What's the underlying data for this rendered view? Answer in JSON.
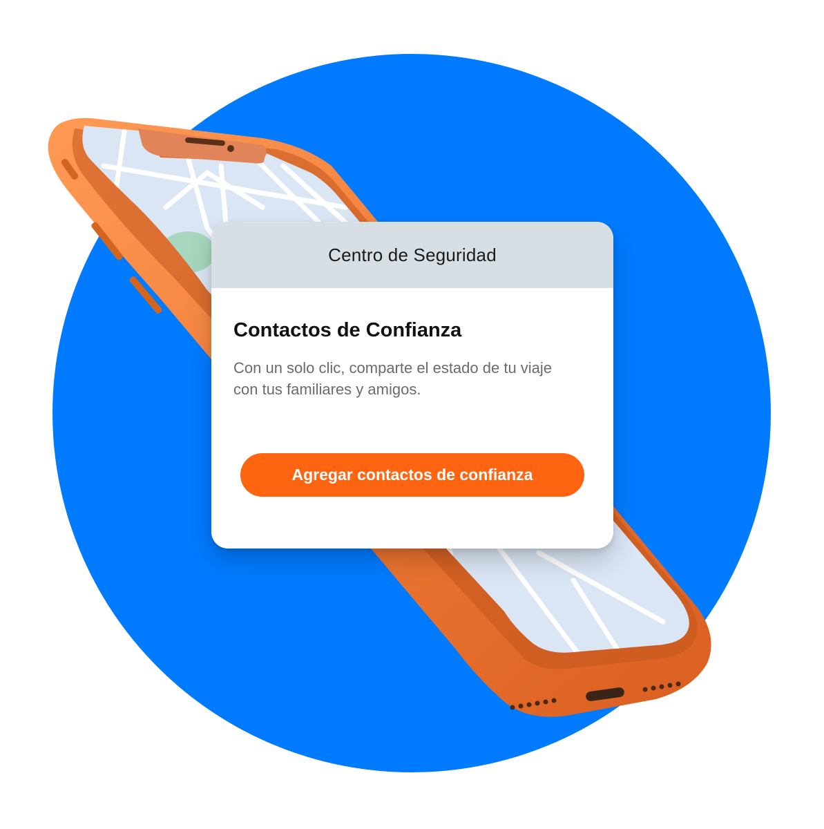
{
  "colors": {
    "circle": "#007bff",
    "phone_frame": "#f07a36",
    "phone_screen": "#dbe6f5",
    "button": "#ff6410",
    "card_header": "#d8dfe4"
  },
  "icons": {
    "background": "blue-circle-icon",
    "device": "smartphone-icon",
    "map": "map-icon"
  },
  "card": {
    "header_title": "Centro de Seguridad",
    "heading": "Contactos de Confianza",
    "description": "Con un solo clic, comparte el estado de tu viaje con tus familiares y amigos.",
    "button_label": "Agregar contactos de confianza"
  }
}
